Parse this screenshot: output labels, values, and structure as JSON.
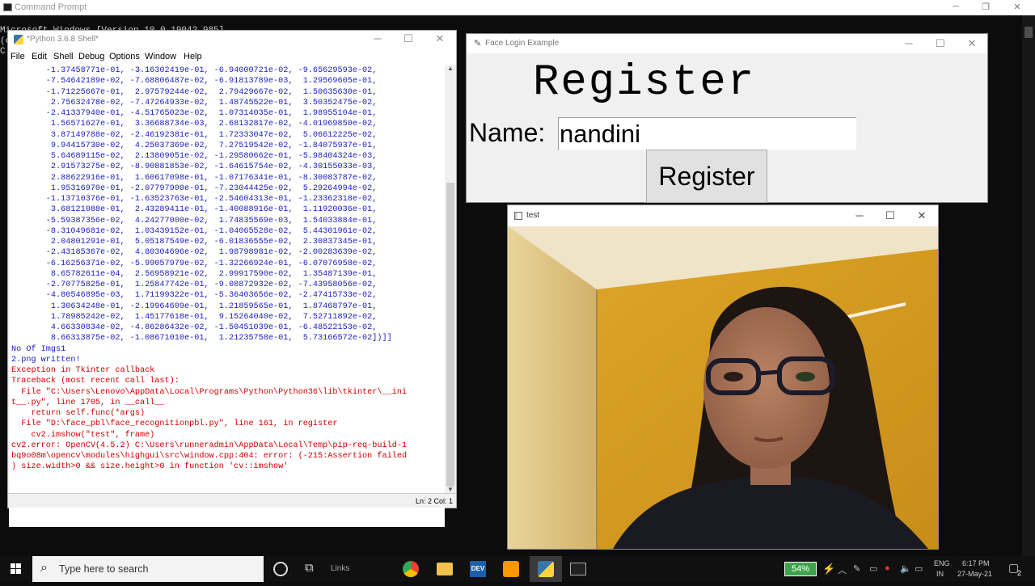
{
  "cmd": {
    "title": "Command Prompt",
    "lines": [
      "Microsoft Windows [Version 10.0.19042.985]",
      "(c",
      "",
      "C:"
    ]
  },
  "idle": {
    "title": "*Python 3.6.8 Shell*",
    "menu": [
      "File",
      "Edit",
      "Shell",
      "Debug",
      "Options",
      "Window",
      "Help"
    ],
    "array_lines": [
      "       -1.37458771e-01, -3.16302419e-01, -6.94000721e-02, -9.65629593e-02,",
      "       -7.54642189e-02, -7.68806487e-02, -6.91813789e-03,  1.29569605e-01,",
      "       -1.71225667e-01,  2.97579244e-02,  2.79429667e-02,  1.50635630e-01,",
      "        2.75632478e-02, -7.47264933e-02,  1.48745522e-01,  3.50352475e-02,",
      "       -2.41337940e-01, -4.51765023e-02,  1.07314035e-01,  1.98955104e-01,",
      "        1.56571627e-01,  3.36688734e-03,  2.68132817e-02, -4.01969850e-02,",
      "        3.87149788e-02, -2.46192381e-01,  1.72333047e-02,  5.06612225e-02,",
      "        9.94415730e-02,  4.25037369e-02,  7.27519542e-02, -1.84075937e-01,",
      "        5.64689115e-02,  2.13809051e-02, -1.29580662e-01, -5.98404324e-03,",
      "        2.91573275e-02, -8.90881853e-02, -1.64615754e-02, -4.30155033e-03,",
      "        2.88622916e-01,  1.60617098e-01, -1.07176341e-01, -8.30083787e-02,",
      "        1.95316970e-01, -2.07797900e-01, -7.23044425e-02,  5.29264994e-02,",
      "       -1.13710376e-01, -1.63523763e-01, -2.54604313e-01, -1.23362318e-02,",
      "        3.68121088e-01,  2.43289411e-01, -1.40088916e-01,  1.11920036e-01,",
      "       -5.59387356e-02,  4.24277000e-02,  1.74835569e-03,  1.54033884e-01,",
      "       -8.31049681e-02,  1.03439152e-01, -1.04065528e-02,  5.44301961e-02,",
      "        2.04801291e-01,  5.05187549e-02, -6.01836555e-02,  2.30837345e-01,",
      "       -2.43185367e-02,  4.80304696e-02,  1.98798981e-02, -2.00283639e-02,",
      "       -6.16256371e-02, -5.99057979e-02, -1.32266924e-01, -6.07076958e-02,",
      "        8.65782611e-04,  2.56958921e-02,  2.99917590e-02,  1.35487139e-01,",
      "       -2.70775825e-01,  1.25847742e-01, -9.08872932e-02, -7.43958056e-02,",
      "       -4.80546895e-03,  1.71199322e-01, -5.36403656e-02, -2.47415733e-02,",
      "        1.30634248e-01, -2.19964609e-01,  1.21859565e-01,  1.87468797e-01,",
      "        1.78985242e-02,  1.45177618e-01,  9.15264040e-02,  7.52711892e-02,",
      "        4.66330834e-02, -4.86286432e-02, -1.50451039e-01, -6.48522153e-02,",
      "        8.66313875e-02, -1.08671010e-01,  1.21235758e-01,  5.73166572e-02])]]"
    ],
    "blue_lines": [
      "No Of Imgs1",
      "2.png written!"
    ],
    "error_lines": [
      "Exception in Tkinter callback",
      "Traceback (most recent call last):",
      "  File \"C:\\Users\\Lenovo\\AppData\\Local\\Programs\\Python\\Python36\\lib\\tkinter\\__ini",
      "t__.py\", line 1705, in __call__",
      "    return self.func(*args)",
      "  File \"D:\\face_pbl\\face_recognitionpbl.py\", line 161, in register",
      "    cv2.imshow(\"test\", frame)",
      "cv2.error: OpenCV(4.5.2) C:\\Users\\runneradmin\\AppData\\Local\\Temp\\pip-req-build-1",
      "bq9o08m\\opencv\\modules\\highgui\\src\\window.cpp:404: error: (-215:Assertion failed",
      ") size.width>0 && size.height>0 in function 'cv::imshow'"
    ],
    "status": "Ln: 2  Col: 1"
  },
  "face_login": {
    "title": "Face Login Example",
    "heading": "Register",
    "name_label": "Name:",
    "name_value": "nandini",
    "button_label": "Register"
  },
  "test_window": {
    "title": "test"
  },
  "taskbar": {
    "search_placeholder": "Type here to search",
    "links_label": "Links",
    "battery": "54%",
    "lang_line1": "ENG",
    "lang_line2": "IN",
    "time": "6:17 PM",
    "date": "27-May-21",
    "notification_count": "2"
  },
  "colors": {
    "idle_output_blue": "#2020c0",
    "idle_error_red": "#d00000",
    "cmd_background": "#0c0c0c",
    "wall_yellow": "#d5a020"
  }
}
